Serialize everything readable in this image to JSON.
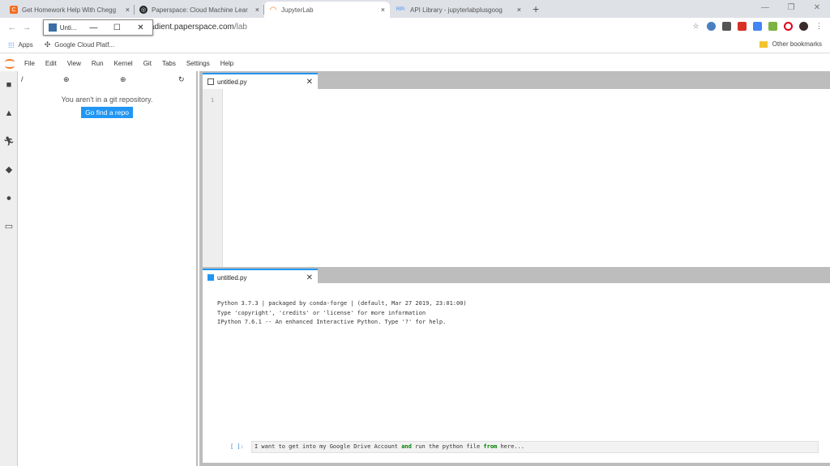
{
  "browser": {
    "tabs": [
      {
        "title": "Get Homework Help With Chegg",
        "icon": "chegg-icon",
        "icon_color": "#f36f21",
        "icon_glyph": "C"
      },
      {
        "title": "Paperspace: Cloud Machine Lear",
        "icon": "paperspace-icon",
        "icon_color": "#222222",
        "icon_glyph": "◎"
      },
      {
        "title": "JupyterLab",
        "icon": "jupyter-icon",
        "icon_color": "#f37726",
        "icon_glyph": "◠"
      },
      {
        "title": "API Library - jupyterlabplusgoog",
        "icon": "api-icon",
        "icon_color": "#4285f4",
        "icon_glyph": "RPI"
      }
    ],
    "close_glyph": "×",
    "new_tab_glyph": "+",
    "address": {
      "host": "gradient.paperspace.com",
      "path": "/lab"
    },
    "mini_window": {
      "label": "Unti..."
    },
    "bookmarks": {
      "apps": "Apps",
      "gcp": "Google Cloud Platf...",
      "other": "Other bookmarks"
    }
  },
  "jupyter": {
    "menu": [
      "File",
      "Edit",
      "View",
      "Run",
      "Kernel",
      "Git",
      "Tabs",
      "Settings",
      "Help"
    ],
    "git_panel": {
      "path": "/",
      "message": "You aren't in a git repository.",
      "button": "Go find a repo"
    },
    "editor_tab": {
      "title": "untitled.py",
      "line_number": "1"
    },
    "console_tab": {
      "title": "untitled.py"
    },
    "console_output": "Python 3.7.3 | packaged by conda-forge | (default, Mar 27 2019, 23:01:00)\nType 'copyright', 'credits' or 'license' for more information\nIPython 7.6.1 -- An enhanced Interactive Python. Type '?' for help.",
    "prompt": "[ ]:",
    "input": {
      "before": "I want to get into my Google Drive Account ",
      "kw1": "and",
      "middle": " run the python file ",
      "kw2": "from",
      "after": " here..."
    },
    "accent": "#2196f3"
  }
}
